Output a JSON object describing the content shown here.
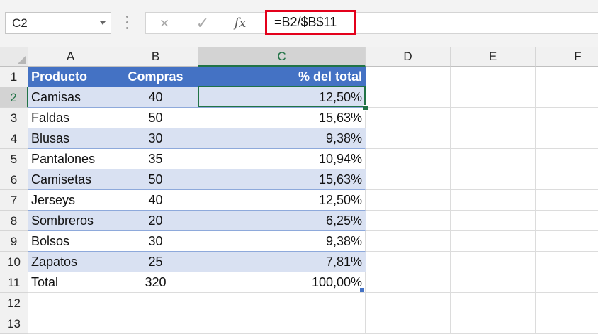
{
  "name_box": {
    "value": "C2"
  },
  "formula_bar": {
    "cancel_icon": "×",
    "enter_icon": "✓",
    "insert_function_label": "fx",
    "formula": "=B2/$B$11"
  },
  "columns": [
    "A",
    "B",
    "C",
    "D",
    "E",
    "F"
  ],
  "rows": [
    "1",
    "2",
    "3",
    "4",
    "5",
    "6",
    "7",
    "8",
    "9",
    "10",
    "11",
    "12",
    "13"
  ],
  "table": {
    "headers": [
      "Producto",
      "Compras",
      "% del total"
    ],
    "data": [
      [
        "Camisas",
        "40",
        "12,50%"
      ],
      [
        "Faldas",
        "50",
        "15,63%"
      ],
      [
        "Blusas",
        "30",
        "9,38%"
      ],
      [
        "Pantalones",
        "35",
        "10,94%"
      ],
      [
        "Camisetas",
        "50",
        "15,63%"
      ],
      [
        "Jerseys",
        "40",
        "12,50%"
      ],
      [
        "Sombreros",
        "20",
        "6,25%"
      ],
      [
        "Bolsos",
        "30",
        "9,38%"
      ],
      [
        "Zapatos",
        "25",
        "7,81%"
      ],
      [
        "Total",
        "320",
        "100,00%"
      ]
    ]
  },
  "active_cell": "C2",
  "colors": {
    "header_fill": "#4472c4",
    "band_fill": "#d9e1f2",
    "selection": "#217346",
    "formula_highlight": "#e3001b"
  }
}
